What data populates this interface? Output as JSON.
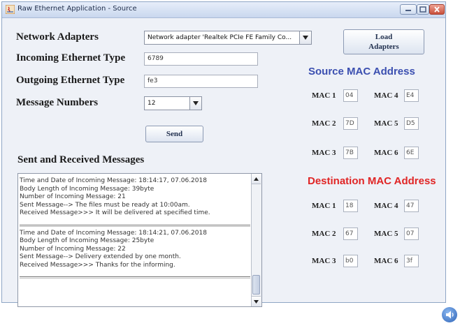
{
  "window": {
    "title": "Raw Ethernet Application - Source"
  },
  "form": {
    "network_adapters_label": "Network Adapters",
    "network_adapter_value": "Network adapter 'Realtek PCIe FE Family Co...",
    "incoming_type_label": "Incoming Ethernet Type",
    "incoming_type_value": "6789",
    "outgoing_type_label": "Outgoing Ethernet Type",
    "outgoing_type_value": "fe3",
    "message_numbers_label": "Message Numbers",
    "message_numbers_value": "12",
    "send_button": "Send",
    "load_adapters_button": "Load\nAdapters"
  },
  "messages": {
    "title": "Sent and Received Messages",
    "block1": [
      "Time and Date of Incoming Message: 18:14:17, 07.06.2018",
      "Body Length of Incoming Message: 39byte",
      "Number of Incoming Message: 21",
      "Sent Message--> The files must be ready at 10:00am.",
      "Received Message>>> It will be delivered at specified time."
    ],
    "block2": [
      "Time and Date of Incoming Message: 18:14:21, 07.06.2018",
      "Body Length of Incoming Message: 25byte",
      "Number of Incoming Message: 22",
      "Sent Message--> Delivery extended by one month.",
      "Received Message>>> Thanks for the informing."
    ]
  },
  "source_mac": {
    "title": "Source MAC Address",
    "mac1_label": "MAC 1",
    "mac1": "04",
    "mac2_label": "MAC 2",
    "mac2": "7D",
    "mac3_label": "MAC 3",
    "mac3": "7B",
    "mac4_label": "MAC 4",
    "mac4": "E4",
    "mac5_label": "MAC 5",
    "mac5": "D5",
    "mac6_label": "MAC 6",
    "mac6": "6E"
  },
  "dest_mac": {
    "title": "Destination MAC Address",
    "mac1_label": "MAC 1",
    "mac1": "18",
    "mac2_label": "MAC 2",
    "mac2": "67",
    "mac3_label": "MAC 3",
    "mac3": "b0",
    "mac4_label": "MAC 4",
    "mac4": "47",
    "mac5_label": "MAC 5",
    "mac5": "07",
    "mac6_label": "MAC 6",
    "mac6": "3f"
  },
  "colors": {
    "source_heading": "#3b4fb0",
    "destination_heading": "#e02525"
  },
  "icons": {
    "title": "java-app-icon",
    "tray": "speaker-icon"
  }
}
